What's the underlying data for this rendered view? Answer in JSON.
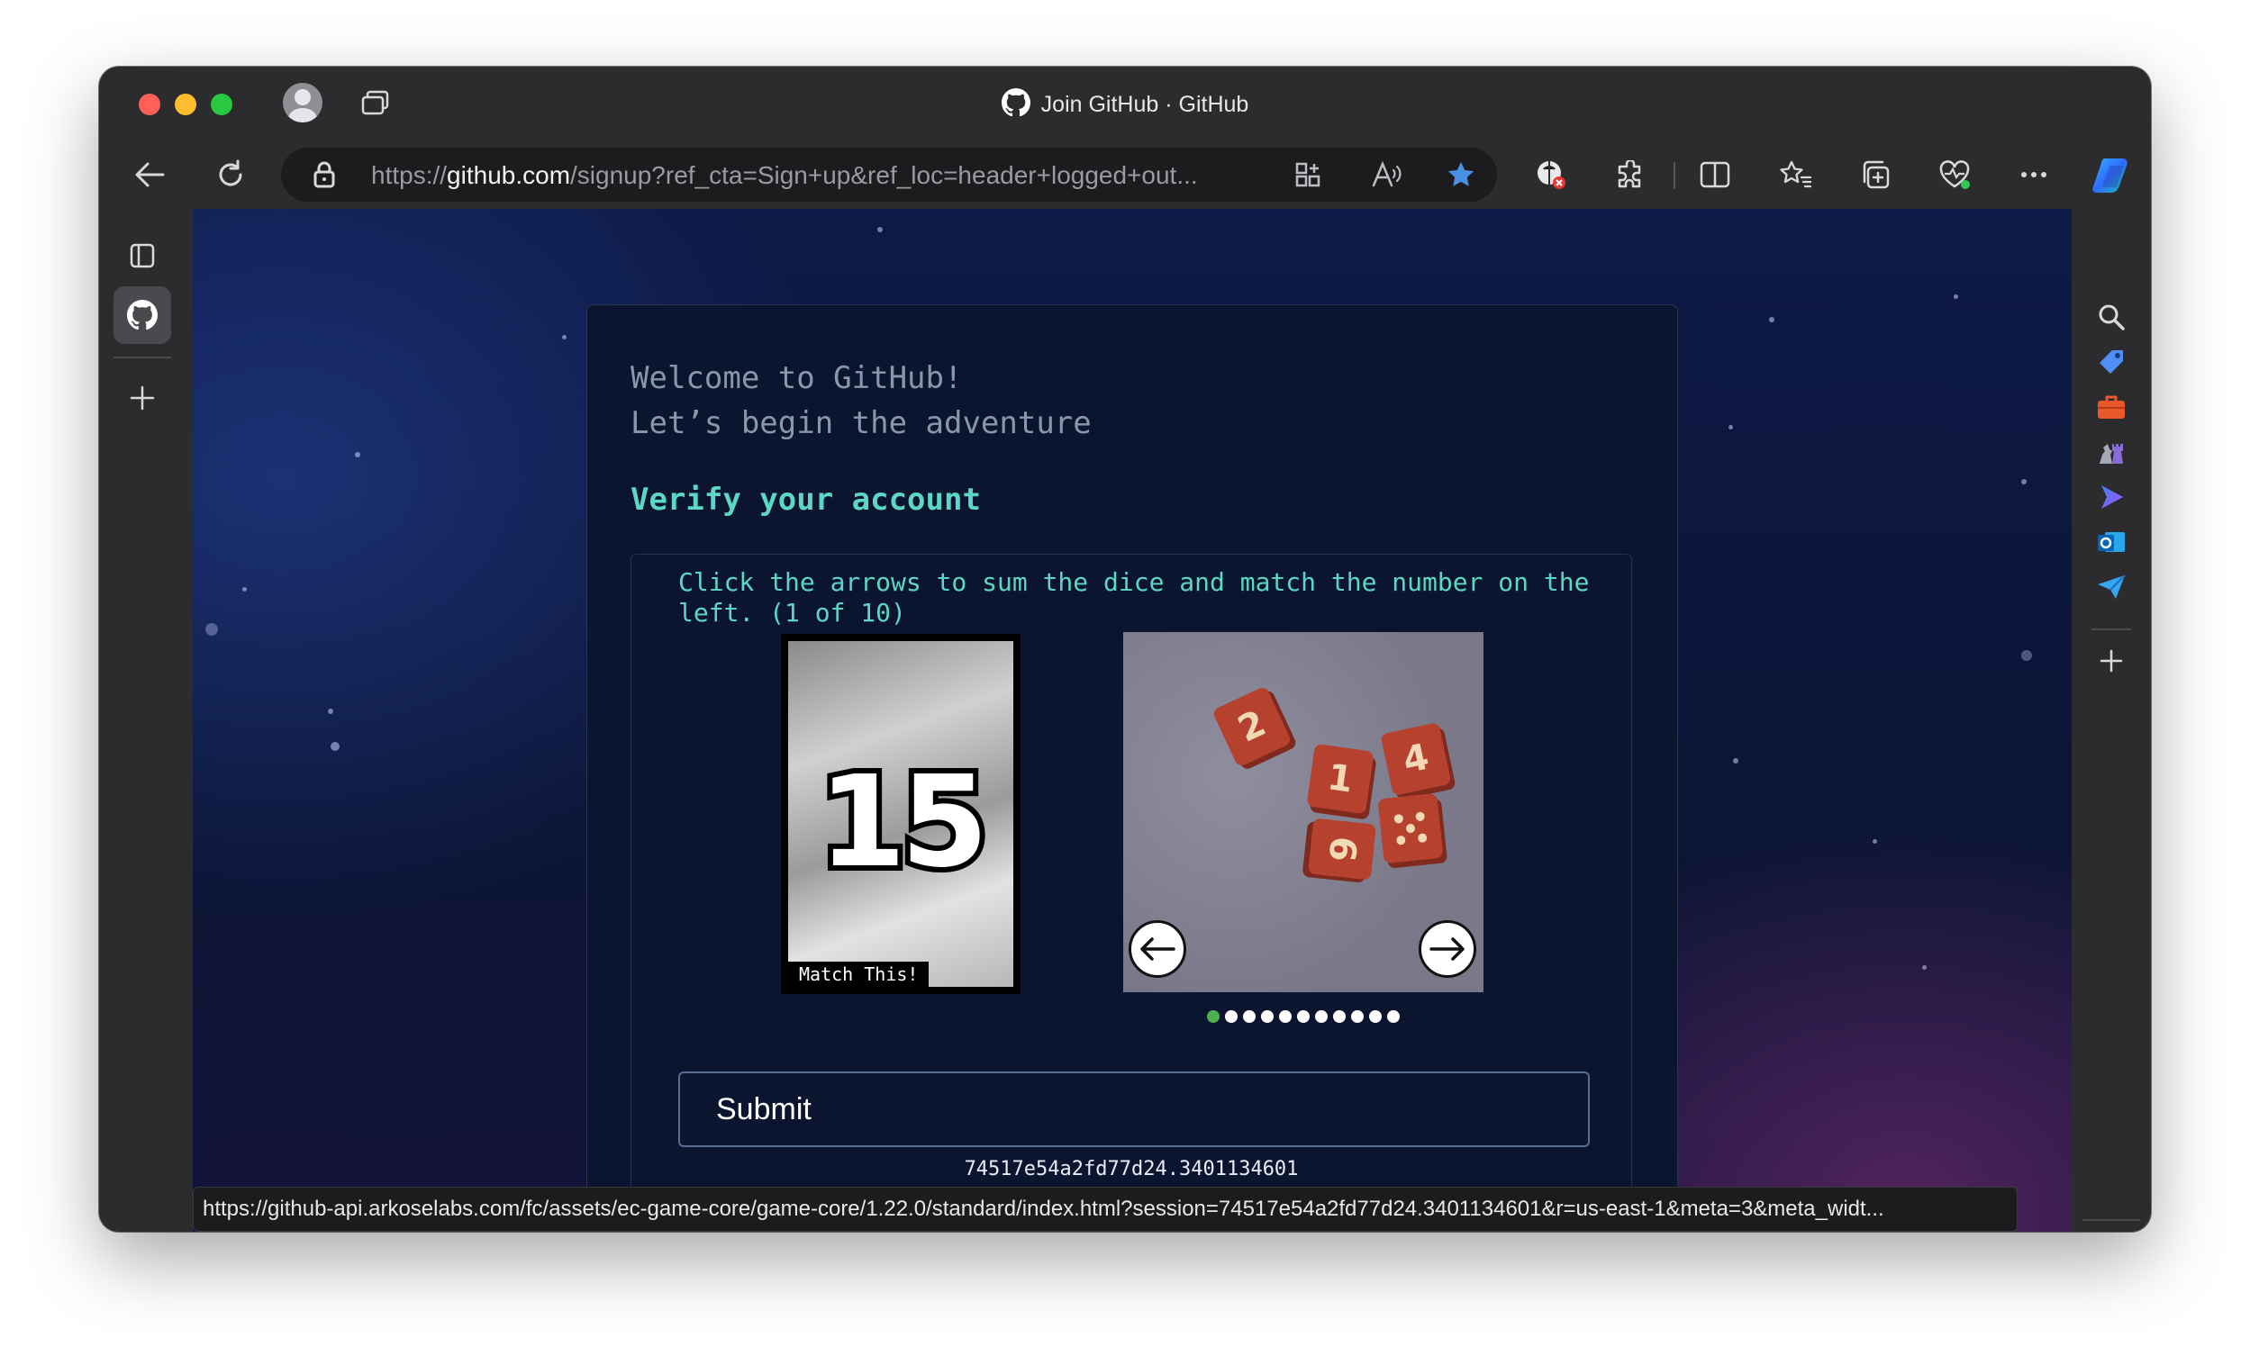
{
  "browser": {
    "window_title": "Join GitHub · GitHub",
    "url_prefix": "https://",
    "url_domain": "github.com",
    "url_rest": "/signup?ref_cta=Sign+up&ref_loc=header+logged+out...",
    "status_url": "https://github-api.arkoselabs.com/fc/assets/ec-game-core/game-core/1.22.0/standard/index.html?session=74517e54a2fd77d24.3401134601&r=us-east-1&meta=3&meta_widt...",
    "icons": {
      "back": "back-arrow-icon",
      "reload": "reload-icon",
      "favorite": "star-filled-icon",
      "more": "more-icon"
    }
  },
  "page": {
    "welcome_line1": "Welcome to GitHub!",
    "welcome_line2": "Let’s begin the adventure",
    "verify_heading": "Verify your account",
    "instruction": "Click the arrows to sum the dice and match the number on the left. (1 of 10)",
    "target_number": "15",
    "match_label": "Match This!",
    "dice_faces": [
      "2",
      "1",
      "4",
      "6"
    ],
    "page_dots_total": 11,
    "page_dots_active": 1,
    "submit_label": "Submit",
    "session_id": "74517e54a2fd77d24.3401134601"
  },
  "colors": {
    "accent": "#5cd6c6",
    "card_bg": "#0c1530",
    "die": "#b5412e"
  }
}
